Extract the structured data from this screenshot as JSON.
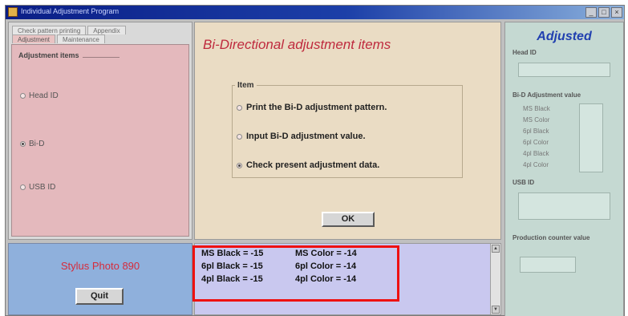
{
  "window": {
    "title": "Individual Adjustment Program"
  },
  "tabs": {
    "row1": [
      "Check pattern printing",
      "Appendix"
    ],
    "row2": [
      "Adjustment",
      "Maintenance"
    ]
  },
  "left": {
    "group_title": "Adjustment items",
    "items": [
      {
        "label": "Head ID",
        "checked": false
      },
      {
        "label": "Bi-D",
        "checked": true
      },
      {
        "label": "USB ID",
        "checked": false
      }
    ]
  },
  "center": {
    "title": "Bi-Directional adjustment items",
    "item_label": "Item",
    "options": [
      {
        "label": "Print the Bi-D adjustment pattern.",
        "checked": false
      },
      {
        "label": "Input Bi-D adjustment value.",
        "checked": false
      },
      {
        "label": "Check present adjustment data.",
        "checked": true
      }
    ],
    "ok_label": "OK"
  },
  "right": {
    "title": "Adjusted",
    "head_id_label": "Head ID",
    "bid_label": "Bi-D Adjustment value",
    "bid_rows": [
      "MS Black",
      "MS Color",
      "6pl Black",
      "6pl Color",
      "4pl Black",
      "4pl Color"
    ],
    "usb_id_label": "USB ID",
    "production_counter_label": "Production counter value"
  },
  "bottom_left": {
    "model": "Stylus Photo 890",
    "quit_label": "Quit"
  },
  "data_lines": [
    {
      "left": "MS Black = -15",
      "right": "MS Color = -14"
    },
    {
      "left": "6pl Black = -15",
      "right": "6pl Color = -14"
    },
    {
      "left": "4pl Black = -15",
      "right": "4pl Color = -14"
    }
  ],
  "colors": {
    "title_bar": "#0a1e86",
    "left_panel": "#e4b9bd",
    "center_panel": "#eadcc4",
    "right_panel": "#c5d9d2",
    "bottom_left": "#8fb0dc",
    "data_area": "#c9c8ef",
    "center_title": "#bf2a3e",
    "adjusted_title": "#2140b0",
    "highlight": "#e11"
  }
}
